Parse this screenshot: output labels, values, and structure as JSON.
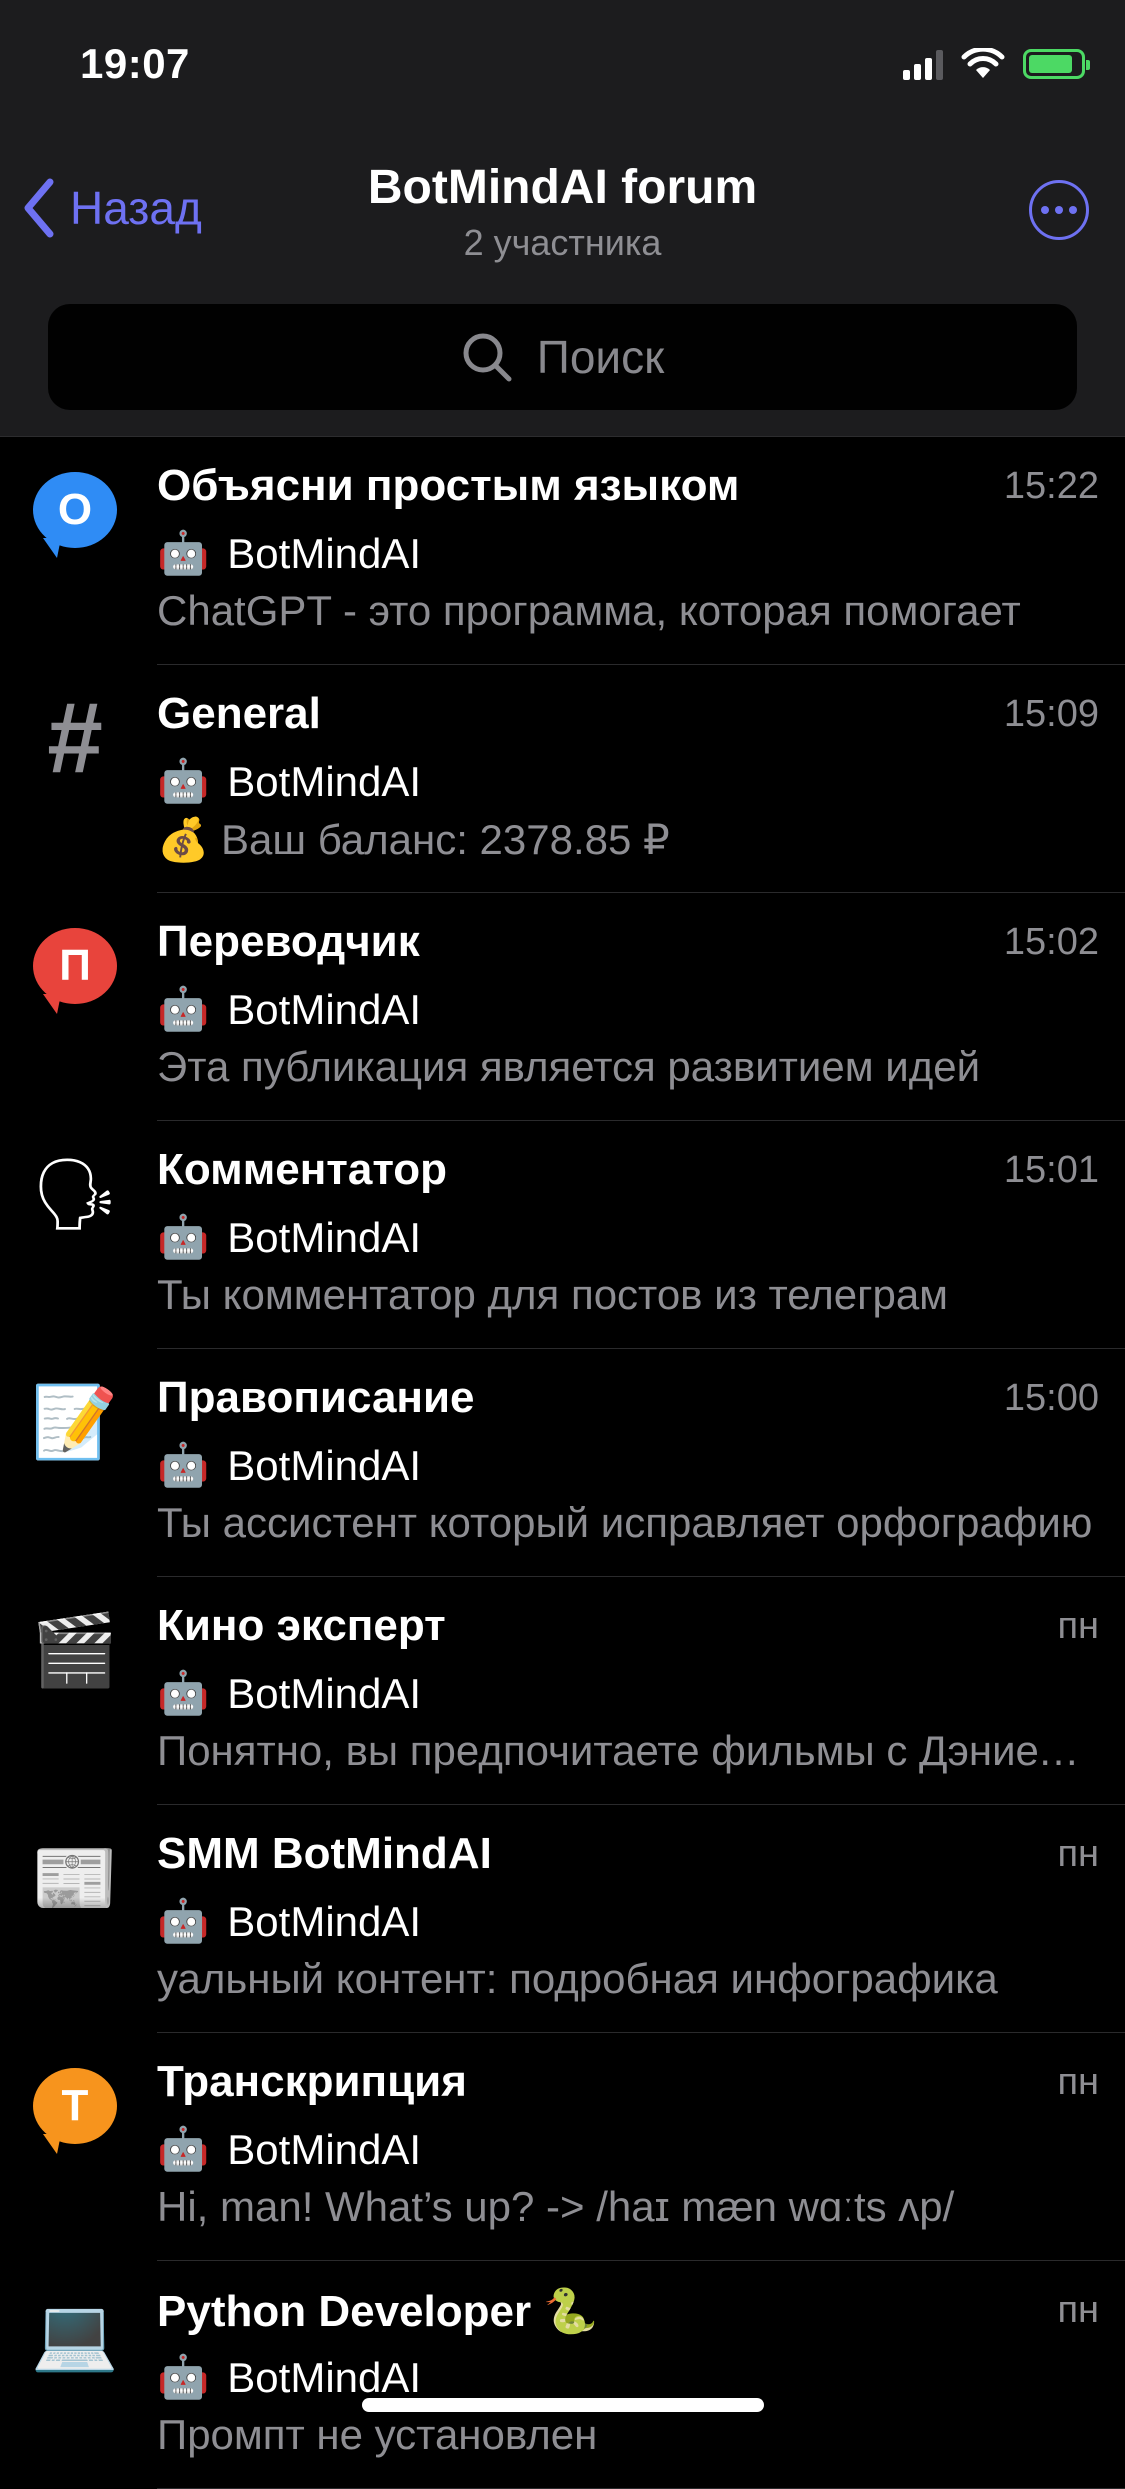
{
  "status": {
    "time": "19:07",
    "battery_level": 0.85
  },
  "nav": {
    "back_label": "Назад",
    "title": "BotMindAI forum",
    "subtitle": "2 участника"
  },
  "search": {
    "placeholder": "Поиск"
  },
  "colors": {
    "accent": "#6e71f2",
    "background": "#000000",
    "bar": "#1c1c1e",
    "secondary_text": "#8e8e93"
  },
  "topics": [
    {
      "icon": "blue-speech-bubble-O",
      "glyph": "О",
      "color": "#2f8cf5",
      "title": "Объясни простым языком",
      "time": "15:22",
      "sender_emoji": "🤖",
      "sender": "BotMindAI",
      "preview": "ChatGPT - это программа, которая помогает"
    },
    {
      "icon": "hash-icon",
      "glyph": "#",
      "color": "#8e8e93",
      "title": "General",
      "time": "15:09",
      "sender_emoji": "🤖",
      "sender": "BotMindAI",
      "preview": "💰 Ваш баланс: 2378.85 ₽"
    },
    {
      "icon": "red-speech-bubble-P",
      "glyph": "П",
      "color": "#e8443c",
      "title": "Переводчик",
      "time": "15:02",
      "sender_emoji": "🤖",
      "sender": "BotMindAI",
      "preview": "Эта публикация является развитием идей"
    },
    {
      "icon": "speaking-head-icon",
      "glyph": "🗣",
      "color": "#5aa0d8",
      "title": "Комментатор",
      "time": "15:01",
      "sender_emoji": "🤖",
      "sender": "BotMindAI",
      "preview": "Ты комментатор для постов из телеграм"
    },
    {
      "icon": "memo-icon",
      "glyph": "📝",
      "color": "#e6e6e6",
      "title": "Правописание",
      "time": "15:00",
      "sender_emoji": "🤖",
      "sender": "BotMindAI",
      "preview": "Ты ассистент который исправляет орфографию"
    },
    {
      "icon": "clapper-board-icon",
      "glyph": "🎬",
      "color": "#cccccc",
      "title": "Кино эксперт",
      "time": "пн",
      "sender_emoji": "🤖",
      "sender": "BotMindAI",
      "preview": "Понятно, вы предпочитаете фильмы с Дэниелом"
    },
    {
      "icon": "newspaper-icon",
      "glyph": "📰",
      "color": "#cccccc",
      "title": "SMM BotMindAI",
      "time": "пн",
      "sender_emoji": "🤖",
      "sender": "BotMindAI",
      "preview": "уальный контент: подробная инфографика"
    },
    {
      "icon": "orange-speech-bubble-T",
      "glyph": "Т",
      "color": "#f7941d",
      "title": "Транскрипция",
      "time": "пн",
      "sender_emoji": "🤖",
      "sender": "BotMindAI",
      "preview": "Hi, man! What’s up? -> /haɪ mæn wɑːts ʌp/"
    },
    {
      "icon": "laptop-icon",
      "glyph": "💻",
      "color": "#cccccc",
      "title": "Python Developer 🐍",
      "time": "пн",
      "sender_emoji": "🤖",
      "sender": "BotMindAI",
      "preview": "Промпт не установлен"
    }
  ]
}
